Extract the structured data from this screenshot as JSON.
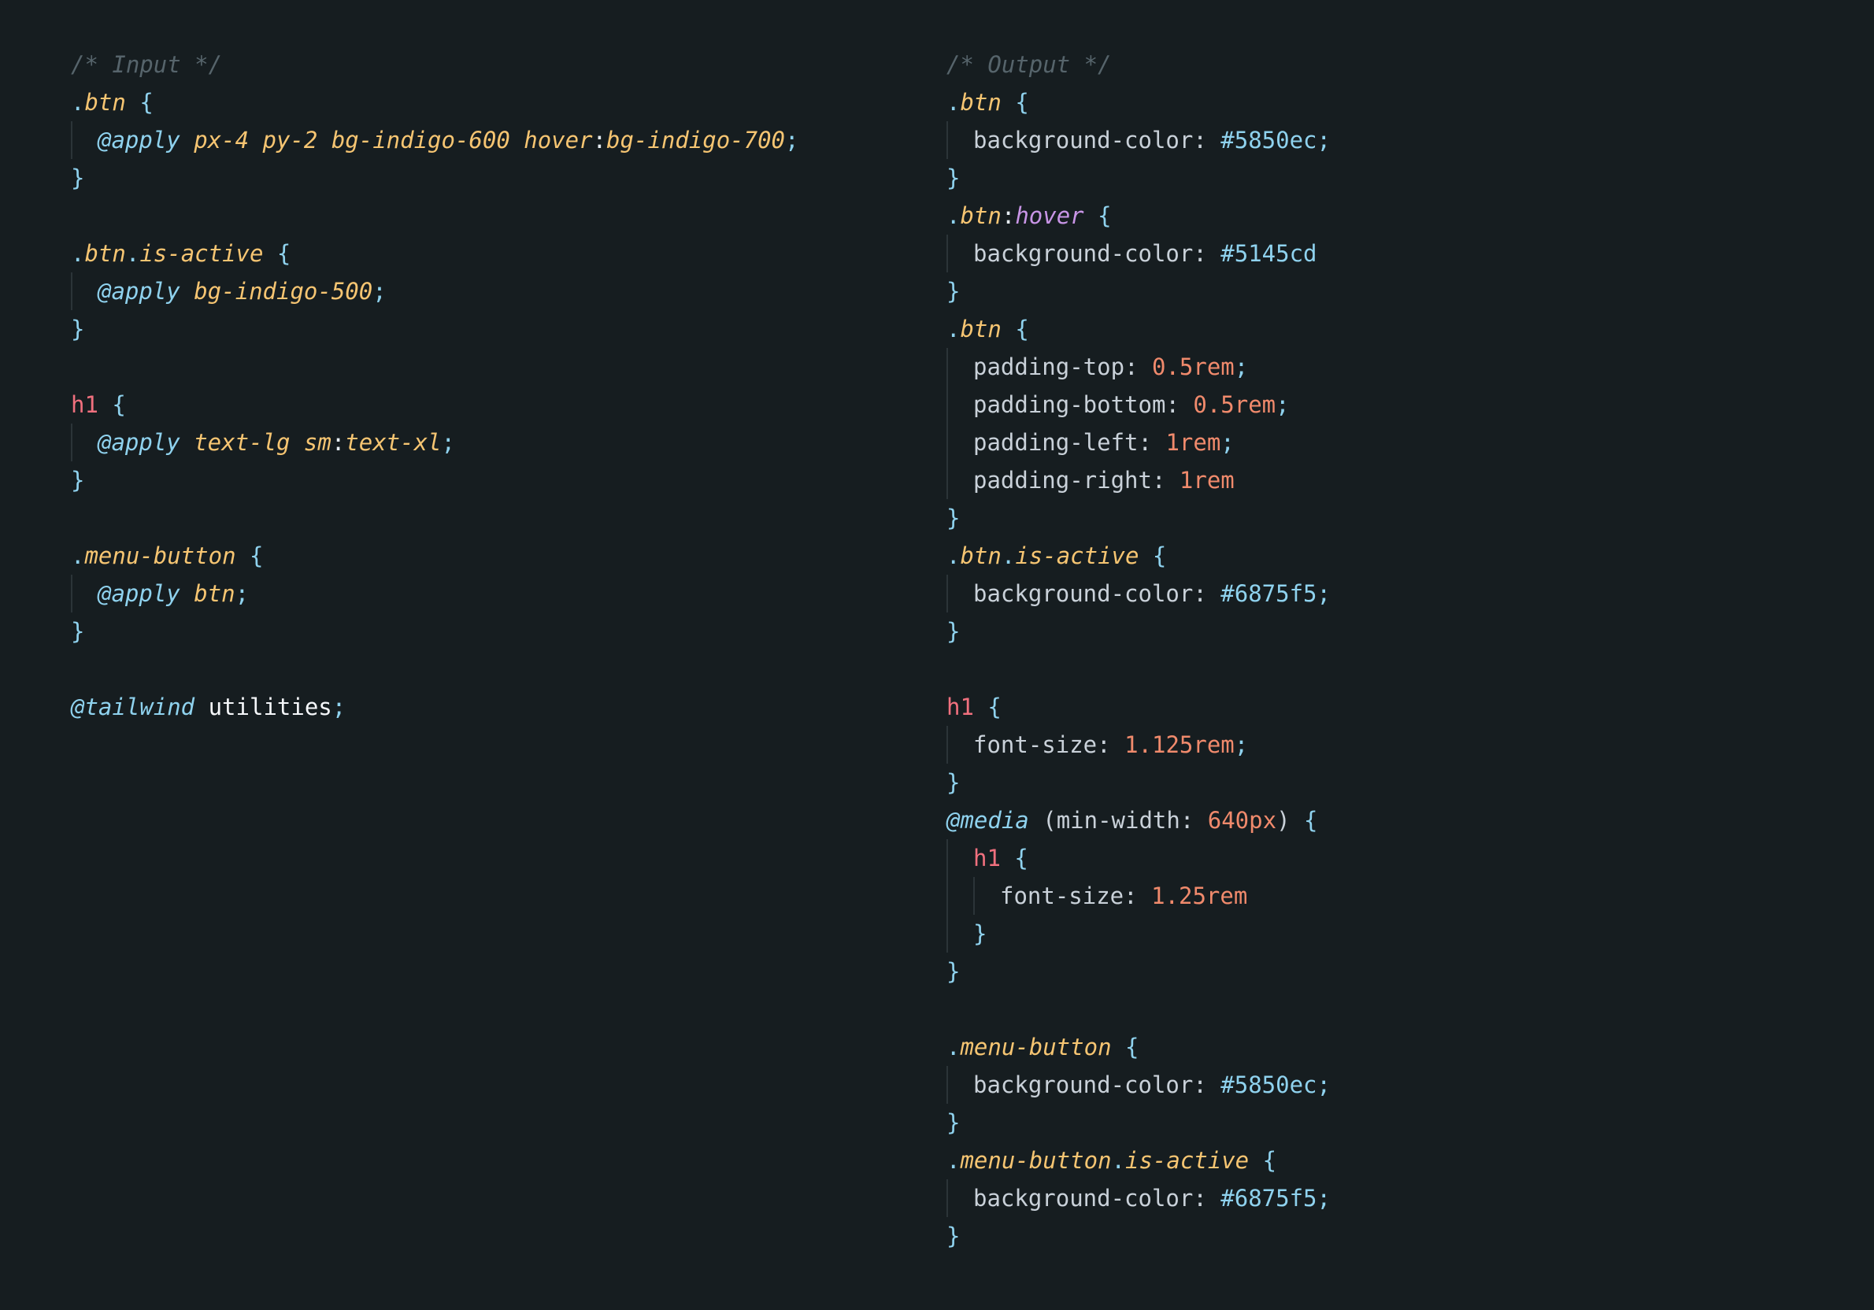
{
  "colors": {
    "background": "#161d20",
    "comment": "#56646b",
    "brace": "#8fd2ee",
    "selector": "#f6c572",
    "at_rule": "#8fd2ee",
    "tag": "#f0707e",
    "property": "#c9d1d9",
    "number": "#f08a6c",
    "pseudo": "#c895e6"
  },
  "panels": [
    {
      "name": "input",
      "lines": [
        {
          "indent": 0,
          "tokens": [
            {
              "t": "/* Input */",
              "c": "comment"
            }
          ]
        },
        {
          "indent": 0,
          "tokens": [
            {
              "t": ".",
              "c": "dot"
            },
            {
              "t": "btn",
              "c": "class"
            },
            {
              "t": " {",
              "c": "brace"
            }
          ]
        },
        {
          "indent": 1,
          "tokens": [
            {
              "t": "@apply",
              "c": "at"
            },
            {
              "t": " px-4 py-2 bg-indigo-600 hover",
              "c": "util"
            },
            {
              "t": ":",
              "c": "colon"
            },
            {
              "t": "bg-indigo-700",
              "c": "util"
            },
            {
              "t": ";",
              "c": "punct"
            }
          ]
        },
        {
          "indent": 0,
          "tokens": [
            {
              "t": "}",
              "c": "brace"
            }
          ]
        },
        {
          "indent": 0,
          "tokens": []
        },
        {
          "indent": 0,
          "tokens": [
            {
              "t": ".",
              "c": "dot"
            },
            {
              "t": "btn",
              "c": "class"
            },
            {
              "t": ".",
              "c": "dot"
            },
            {
              "t": "is-active",
              "c": "class"
            },
            {
              "t": " {",
              "c": "brace"
            }
          ]
        },
        {
          "indent": 1,
          "tokens": [
            {
              "t": "@apply",
              "c": "at"
            },
            {
              "t": " bg-indigo-500",
              "c": "util"
            },
            {
              "t": ";",
              "c": "punct"
            }
          ]
        },
        {
          "indent": 0,
          "tokens": [
            {
              "t": "}",
              "c": "brace"
            }
          ]
        },
        {
          "indent": 0,
          "tokens": []
        },
        {
          "indent": 0,
          "tokens": [
            {
              "t": "h1",
              "c": "tag"
            },
            {
              "t": " {",
              "c": "brace"
            }
          ]
        },
        {
          "indent": 1,
          "tokens": [
            {
              "t": "@apply",
              "c": "at"
            },
            {
              "t": " text-lg sm",
              "c": "util"
            },
            {
              "t": ":",
              "c": "colon"
            },
            {
              "t": "text-xl",
              "c": "util"
            },
            {
              "t": ";",
              "c": "punct"
            }
          ]
        },
        {
          "indent": 0,
          "tokens": [
            {
              "t": "}",
              "c": "brace"
            }
          ]
        },
        {
          "indent": 0,
          "tokens": []
        },
        {
          "indent": 0,
          "tokens": [
            {
              "t": ".",
              "c": "dot"
            },
            {
              "t": "menu-button",
              "c": "class"
            },
            {
              "t": " {",
              "c": "brace"
            }
          ]
        },
        {
          "indent": 1,
          "tokens": [
            {
              "t": "@apply",
              "c": "at"
            },
            {
              "t": " btn",
              "c": "util"
            },
            {
              "t": ";",
              "c": "punct"
            }
          ]
        },
        {
          "indent": 0,
          "tokens": [
            {
              "t": "}",
              "c": "brace"
            }
          ]
        },
        {
          "indent": 0,
          "tokens": []
        },
        {
          "indent": 0,
          "tokens": [
            {
              "t": "@tailwind",
              "c": "at"
            },
            {
              "t": " utilities",
              "c": "plain"
            },
            {
              "t": ";",
              "c": "punct"
            }
          ]
        }
      ]
    },
    {
      "name": "output",
      "lines": [
        {
          "indent": 0,
          "tokens": [
            {
              "t": "/* Output */",
              "c": "comment"
            }
          ]
        },
        {
          "indent": 0,
          "tokens": [
            {
              "t": ".",
              "c": "dot"
            },
            {
              "t": "btn",
              "c": "class"
            },
            {
              "t": " {",
              "c": "brace"
            }
          ]
        },
        {
          "indent": 1,
          "tokens": [
            {
              "t": "background-color",
              "c": "prop"
            },
            {
              "t": ": ",
              "c": "prop"
            },
            {
              "t": "#5850ec",
              "c": "hex"
            },
            {
              "t": ";",
              "c": "punct"
            }
          ]
        },
        {
          "indent": 0,
          "tokens": [
            {
              "t": "}",
              "c": "brace"
            }
          ]
        },
        {
          "indent": 0,
          "tokens": [
            {
              "t": ".",
              "c": "dot"
            },
            {
              "t": "btn",
              "c": "class"
            },
            {
              "t": ":",
              "c": "colon"
            },
            {
              "t": "hover",
              "c": "pseudo"
            },
            {
              "t": " {",
              "c": "brace"
            }
          ]
        },
        {
          "indent": 1,
          "tokens": [
            {
              "t": "background-color",
              "c": "prop"
            },
            {
              "t": ": ",
              "c": "prop"
            },
            {
              "t": "#5145cd",
              "c": "hex"
            }
          ]
        },
        {
          "indent": 0,
          "tokens": [
            {
              "t": "}",
              "c": "brace"
            }
          ]
        },
        {
          "indent": 0,
          "tokens": [
            {
              "t": ".",
              "c": "dot"
            },
            {
              "t": "btn",
              "c": "class"
            },
            {
              "t": " {",
              "c": "brace"
            }
          ]
        },
        {
          "indent": 1,
          "tokens": [
            {
              "t": "padding-top",
              "c": "prop"
            },
            {
              "t": ": ",
              "c": "prop"
            },
            {
              "t": "0.5rem",
              "c": "num"
            },
            {
              "t": ";",
              "c": "punct"
            }
          ]
        },
        {
          "indent": 1,
          "tokens": [
            {
              "t": "padding-bottom",
              "c": "prop"
            },
            {
              "t": ": ",
              "c": "prop"
            },
            {
              "t": "0.5rem",
              "c": "num"
            },
            {
              "t": ";",
              "c": "punct"
            }
          ]
        },
        {
          "indent": 1,
          "tokens": [
            {
              "t": "padding-left",
              "c": "prop"
            },
            {
              "t": ": ",
              "c": "prop"
            },
            {
              "t": "1rem",
              "c": "num"
            },
            {
              "t": ";",
              "c": "punct"
            }
          ]
        },
        {
          "indent": 1,
          "tokens": [
            {
              "t": "padding-right",
              "c": "prop"
            },
            {
              "t": ": ",
              "c": "prop"
            },
            {
              "t": "1rem",
              "c": "num"
            }
          ]
        },
        {
          "indent": 0,
          "tokens": [
            {
              "t": "}",
              "c": "brace"
            }
          ]
        },
        {
          "indent": 0,
          "tokens": [
            {
              "t": ".",
              "c": "dot"
            },
            {
              "t": "btn",
              "c": "class"
            },
            {
              "t": ".",
              "c": "dot"
            },
            {
              "t": "is-active",
              "c": "class"
            },
            {
              "t": " {",
              "c": "brace"
            }
          ]
        },
        {
          "indent": 1,
          "tokens": [
            {
              "t": "background-color",
              "c": "prop"
            },
            {
              "t": ": ",
              "c": "prop"
            },
            {
              "t": "#6875f5",
              "c": "hex"
            },
            {
              "t": ";",
              "c": "punct"
            }
          ]
        },
        {
          "indent": 0,
          "tokens": [
            {
              "t": "}",
              "c": "brace"
            }
          ]
        },
        {
          "indent": 0,
          "tokens": []
        },
        {
          "indent": 0,
          "tokens": [
            {
              "t": "h1",
              "c": "tag"
            },
            {
              "t": " {",
              "c": "brace"
            }
          ]
        },
        {
          "indent": 1,
          "tokens": [
            {
              "t": "font-size",
              "c": "prop"
            },
            {
              "t": ": ",
              "c": "prop"
            },
            {
              "t": "1.125rem",
              "c": "num"
            },
            {
              "t": ";",
              "c": "punct"
            }
          ]
        },
        {
          "indent": 0,
          "tokens": [
            {
              "t": "}",
              "c": "brace"
            }
          ]
        },
        {
          "indent": 0,
          "tokens": [
            {
              "t": "@media",
              "c": "at"
            },
            {
              "t": " (",
              "c": "prop"
            },
            {
              "t": "min-width",
              "c": "prop"
            },
            {
              "t": ": ",
              "c": "prop"
            },
            {
              "t": "640px",
              "c": "num"
            },
            {
              "t": ")",
              "c": "prop"
            },
            {
              "t": " {",
              "c": "brace"
            }
          ]
        },
        {
          "indent": 1,
          "tokens": [
            {
              "t": "h1",
              "c": "tag"
            },
            {
              "t": " {",
              "c": "brace"
            }
          ]
        },
        {
          "indent": 2,
          "tokens": [
            {
              "t": "font-size",
              "c": "prop"
            },
            {
              "t": ": ",
              "c": "prop"
            },
            {
              "t": "1.25rem",
              "c": "num"
            }
          ]
        },
        {
          "indent": 1,
          "tokens": [
            {
              "t": "}",
              "c": "brace"
            }
          ]
        },
        {
          "indent": 0,
          "tokens": [
            {
              "t": "}",
              "c": "brace"
            }
          ]
        },
        {
          "indent": 0,
          "tokens": []
        },
        {
          "indent": 0,
          "tokens": [
            {
              "t": ".",
              "c": "dot"
            },
            {
              "t": "menu-button",
              "c": "class"
            },
            {
              "t": " {",
              "c": "brace"
            }
          ]
        },
        {
          "indent": 1,
          "tokens": [
            {
              "t": "background-color",
              "c": "prop"
            },
            {
              "t": ": ",
              "c": "prop"
            },
            {
              "t": "#5850ec",
              "c": "hex"
            },
            {
              "t": ";",
              "c": "punct"
            }
          ]
        },
        {
          "indent": 0,
          "tokens": [
            {
              "t": "}",
              "c": "brace"
            }
          ]
        },
        {
          "indent": 0,
          "tokens": [
            {
              "t": ".",
              "c": "dot"
            },
            {
              "t": "menu-button",
              "c": "class"
            },
            {
              "t": ".",
              "c": "dot"
            },
            {
              "t": "is-active",
              "c": "class"
            },
            {
              "t": " {",
              "c": "brace"
            }
          ]
        },
        {
          "indent": 1,
          "tokens": [
            {
              "t": "background-color",
              "c": "prop"
            },
            {
              "t": ": ",
              "c": "prop"
            },
            {
              "t": "#6875f5",
              "c": "hex"
            },
            {
              "t": ";",
              "c": "punct"
            }
          ]
        },
        {
          "indent": 0,
          "tokens": [
            {
              "t": "}",
              "c": "brace"
            }
          ]
        }
      ]
    }
  ]
}
